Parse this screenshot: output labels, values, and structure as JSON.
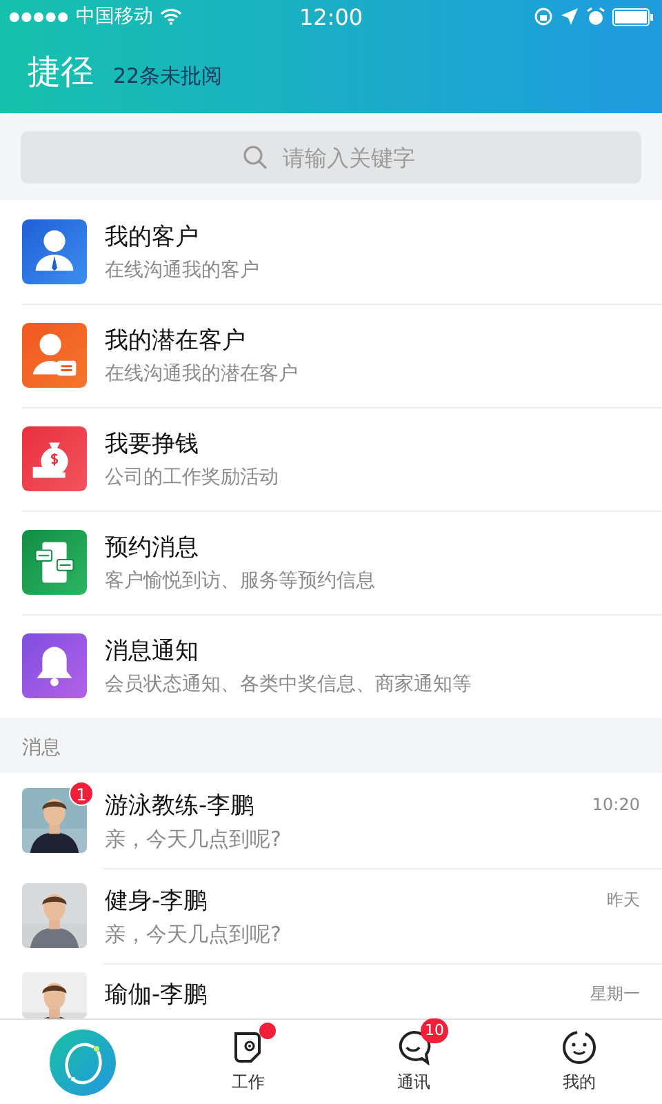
{
  "status_bar": {
    "carrier": "中国移动",
    "time": "12:00"
  },
  "header": {
    "title": "捷径",
    "subtitle": "22条未批阅"
  },
  "search": {
    "placeholder": "请输入关键字"
  },
  "shortcuts": [
    {
      "kind": "customer",
      "title": "我的客户",
      "subtitle": "在线沟通我的客户"
    },
    {
      "kind": "prospect",
      "title": "我的潜在客户",
      "subtitle": "在线沟通我的潜在客户"
    },
    {
      "kind": "money",
      "title": "我要挣钱",
      "subtitle": "公司的工作奖励活动"
    },
    {
      "kind": "booking",
      "title": "预约消息",
      "subtitle": "客户愉悦到访、服务等预约信息"
    },
    {
      "kind": "bell",
      "title": "消息通知",
      "subtitle": "会员状态通知、各类中奖信息、商家通知等"
    }
  ],
  "messages_section": {
    "label": "消息"
  },
  "messages": [
    {
      "name": "游泳教练-李鹏",
      "preview": "亲，今天几点到呢?",
      "time": "10:20",
      "badge": "1"
    },
    {
      "name": "健身-李鹏",
      "preview": "亲，今天几点到呢?",
      "time": "昨天"
    },
    {
      "name": "瑜伽-李鹏",
      "time": "星期一"
    }
  ],
  "tab_bar": [
    {
      "kind": "logo"
    },
    {
      "kind": "work",
      "label": "工作",
      "dot": true
    },
    {
      "kind": "chat",
      "label": "通讯",
      "badge": "10"
    },
    {
      "kind": "me",
      "label": "我的"
    }
  ]
}
